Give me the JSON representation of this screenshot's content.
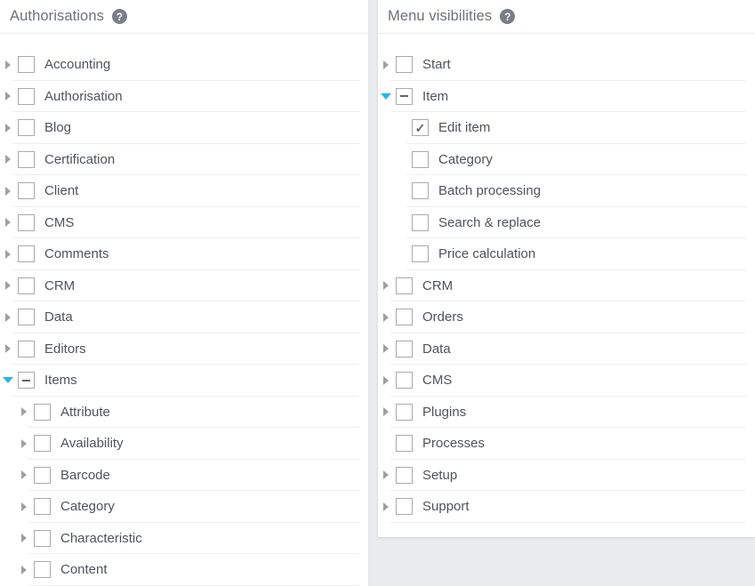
{
  "colors": {
    "page_background": "#e9ebec",
    "panel_background": "#ffffff",
    "title_text": "#6c727a",
    "label_text": "#4e545c",
    "divider": "#eceef0",
    "checkbox_border": "#a7aab0",
    "expanded_arrow": "#29b6e8",
    "collapsed_arrow": "#9aa0a6",
    "help_icon_background": "#787e87"
  },
  "left_panel": {
    "title": "Authorisations",
    "help_icon": "question-mark-circle-icon",
    "help_icon_glyph": "?",
    "items": [
      {
        "label": "Accounting",
        "level": 0,
        "expandable": true,
        "expanded": false,
        "state": "unchecked"
      },
      {
        "label": "Authorisation",
        "level": 0,
        "expandable": true,
        "expanded": false,
        "state": "unchecked"
      },
      {
        "label": "Blog",
        "level": 0,
        "expandable": true,
        "expanded": false,
        "state": "unchecked"
      },
      {
        "label": "Certification",
        "level": 0,
        "expandable": true,
        "expanded": false,
        "state": "unchecked"
      },
      {
        "label": "Client",
        "level": 0,
        "expandable": true,
        "expanded": false,
        "state": "unchecked"
      },
      {
        "label": "CMS",
        "level": 0,
        "expandable": true,
        "expanded": false,
        "state": "unchecked"
      },
      {
        "label": "Comments",
        "level": 0,
        "expandable": true,
        "expanded": false,
        "state": "unchecked"
      },
      {
        "label": "CRM",
        "level": 0,
        "expandable": true,
        "expanded": false,
        "state": "unchecked"
      },
      {
        "label": "Data",
        "level": 0,
        "expandable": true,
        "expanded": false,
        "state": "unchecked"
      },
      {
        "label": "Editors",
        "level": 0,
        "expandable": true,
        "expanded": false,
        "state": "unchecked"
      },
      {
        "label": "Items",
        "level": 0,
        "expandable": true,
        "expanded": true,
        "state": "indeterminate"
      },
      {
        "label": "Attribute",
        "level": 1,
        "expandable": true,
        "expanded": false,
        "state": "unchecked"
      },
      {
        "label": "Availability",
        "level": 1,
        "expandable": true,
        "expanded": false,
        "state": "unchecked"
      },
      {
        "label": "Barcode",
        "level": 1,
        "expandable": true,
        "expanded": false,
        "state": "unchecked"
      },
      {
        "label": "Category",
        "level": 1,
        "expandable": true,
        "expanded": false,
        "state": "unchecked"
      },
      {
        "label": "Characteristic",
        "level": 1,
        "expandable": true,
        "expanded": false,
        "state": "unchecked"
      },
      {
        "label": "Content",
        "level": 1,
        "expandable": true,
        "expanded": false,
        "state": "unchecked"
      }
    ]
  },
  "right_panel": {
    "title": "Menu visibilities",
    "help_icon": "question-mark-circle-icon",
    "help_icon_glyph": "?",
    "items": [
      {
        "label": "Start",
        "level": 0,
        "expandable": true,
        "expanded": false,
        "state": "unchecked"
      },
      {
        "label": "Item",
        "level": 0,
        "expandable": true,
        "expanded": true,
        "state": "indeterminate"
      },
      {
        "label": "Edit item",
        "level": 1,
        "expandable": false,
        "expanded": false,
        "state": "checked"
      },
      {
        "label": "Category",
        "level": 1,
        "expandable": false,
        "expanded": false,
        "state": "unchecked"
      },
      {
        "label": "Batch processing",
        "level": 1,
        "expandable": false,
        "expanded": false,
        "state": "unchecked"
      },
      {
        "label": "Search & replace",
        "level": 1,
        "expandable": false,
        "expanded": false,
        "state": "unchecked"
      },
      {
        "label": "Price calculation",
        "level": 1,
        "expandable": false,
        "expanded": false,
        "state": "unchecked"
      },
      {
        "label": "CRM",
        "level": 0,
        "expandable": true,
        "expanded": false,
        "state": "unchecked"
      },
      {
        "label": "Orders",
        "level": 0,
        "expandable": true,
        "expanded": false,
        "state": "unchecked"
      },
      {
        "label": "Data",
        "level": 0,
        "expandable": true,
        "expanded": false,
        "state": "unchecked"
      },
      {
        "label": "CMS",
        "level": 0,
        "expandable": true,
        "expanded": false,
        "state": "unchecked"
      },
      {
        "label": "Plugins",
        "level": 0,
        "expandable": true,
        "expanded": false,
        "state": "unchecked"
      },
      {
        "label": "Processes",
        "level": 0,
        "expandable": false,
        "expanded": false,
        "state": "unchecked"
      },
      {
        "label": "Setup",
        "level": 0,
        "expandable": true,
        "expanded": false,
        "state": "unchecked"
      },
      {
        "label": "Support",
        "level": 0,
        "expandable": true,
        "expanded": false,
        "state": "unchecked"
      }
    ]
  }
}
